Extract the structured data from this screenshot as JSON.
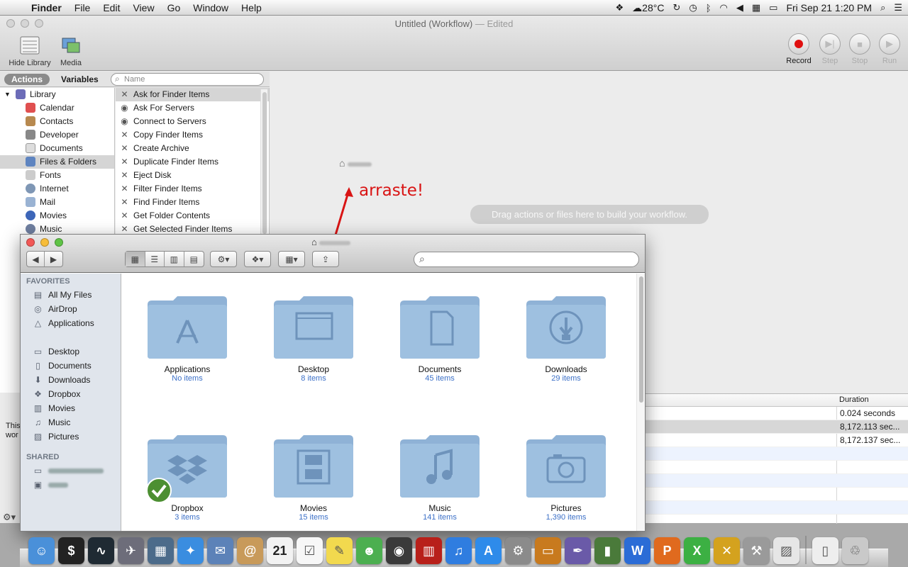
{
  "menubar": {
    "app_name": "Finder",
    "menus": [
      "File",
      "Edit",
      "View",
      "Go",
      "Window",
      "Help"
    ],
    "temperature": "28°C",
    "datetime": "Fri Sep 21  1:20 PM"
  },
  "automator": {
    "title": "Untitled (Workflow)",
    "title_state": "— Edited",
    "toolbar": {
      "hide_library": "Hide Library",
      "media": "Media",
      "record": "Record",
      "step": "Step",
      "stop": "Stop",
      "run": "Run"
    },
    "tabs": {
      "actions": "Actions",
      "variables": "Variables"
    },
    "search_placeholder": "Name",
    "library_root": "Library",
    "categories": [
      "Calendar",
      "Contacts",
      "Developer",
      "Documents",
      "Files & Folders",
      "Fonts",
      "Internet",
      "Mail",
      "Movies",
      "Music"
    ],
    "selected_category": "Files & Folders",
    "actions": [
      "Ask for Finder Items",
      "Ask For Servers",
      "Connect to Servers",
      "Copy Finder Items",
      "Create Archive",
      "Duplicate Finder Items",
      "Eject Disk",
      "Filter Finder Items",
      "Find Finder Items",
      "Get Folder Contents",
      "Get Selected Finder Items"
    ],
    "canvas_hint": "Drag actions or files here to build your workflow.",
    "annotation": "arraste!",
    "log": {
      "column_duration": "Duration",
      "rows": [
        "0.024 seconds",
        "8,172.113 sec...",
        "8,172.137 sec..."
      ]
    },
    "left_snippet": "This\nwor"
  },
  "finder": {
    "sidebar": {
      "favorites_heading": "FAVORITES",
      "favorites": [
        {
          "label": "All My Files",
          "icon": "all-files-icon"
        },
        {
          "label": "AirDrop",
          "icon": "airdrop-icon"
        },
        {
          "label": "Applications",
          "icon": "applications-icon"
        }
      ],
      "places": [
        {
          "label": "Desktop",
          "icon": "desktop-icon"
        },
        {
          "label": "Documents",
          "icon": "documents-icon"
        },
        {
          "label": "Downloads",
          "icon": "downloads-icon"
        },
        {
          "label": "Dropbox",
          "icon": "dropbox-icon"
        },
        {
          "label": "Movies",
          "icon": "movies-icon"
        },
        {
          "label": "Music",
          "icon": "music-icon"
        },
        {
          "label": "Pictures",
          "icon": "pictures-icon"
        }
      ],
      "shared_heading": "SHARED"
    },
    "folders": [
      {
        "name": "Applications",
        "count": "No items",
        "glyph": "applications"
      },
      {
        "name": "Desktop",
        "count": "8 items",
        "glyph": "desktop"
      },
      {
        "name": "Documents",
        "count": "45 items",
        "glyph": "documents"
      },
      {
        "name": "Downloads",
        "count": "29 items",
        "glyph": "downloads"
      },
      {
        "name": "Dropbox",
        "count": "3 items",
        "glyph": "dropbox"
      },
      {
        "name": "Movies",
        "count": "15 items",
        "glyph": "movies"
      },
      {
        "name": "Music",
        "count": "141 items",
        "glyph": "music"
      },
      {
        "name": "Pictures",
        "count": "1,390 items",
        "glyph": "pictures"
      }
    ]
  },
  "dock": {
    "calendar_day": "21"
  },
  "colors": {
    "folder_blue": "#9ec0e0",
    "accent_red": "#d91414",
    "item_count_blue": "#3c70c7"
  }
}
